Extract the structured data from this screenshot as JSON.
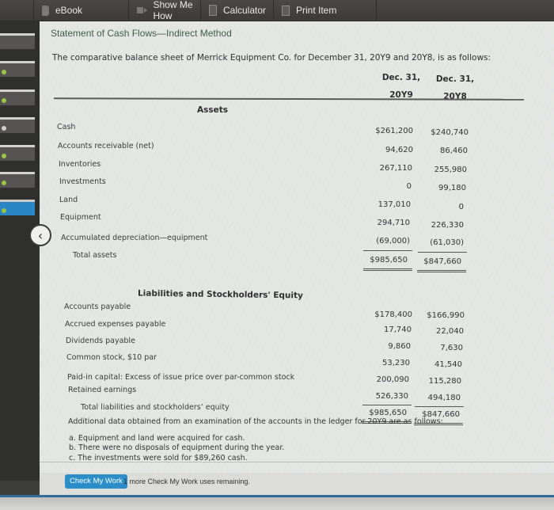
{
  "toolbar": {
    "items": [
      {
        "label": "eBook",
        "icon": "book-icon"
      },
      {
        "label": "Show Me How",
        "icon": "video-icon"
      },
      {
        "label": "Calculator",
        "icon": "calculator-icon"
      },
      {
        "label": "Print Item",
        "icon": "print-icon"
      }
    ]
  },
  "problem": {
    "title": "Statement of Cash Flows—Indirect Method",
    "intro": "The comparative balance sheet of Merrick Equipment Co. for December 31, 20Y9 and 20Y8, is as follows:",
    "columns": [
      {
        "line1": "Dec. 31,",
        "line2": "20Y9"
      },
      {
        "line1": "Dec. 31,",
        "line2": "20Y8"
      }
    ],
    "assets": {
      "heading": "Assets",
      "rows": [
        {
          "label": "Cash",
          "y9": "$261,200",
          "y8": "$240,740"
        },
        {
          "label": "Accounts receivable (net)",
          "y9": "94,620",
          "y8": "86,460"
        },
        {
          "label": "Inventories",
          "y9": "267,110",
          "y8": "255,980"
        },
        {
          "label": "Investments",
          "y9": "0",
          "y8": "99,180"
        },
        {
          "label": "Land",
          "y9": "137,010",
          "y8": "0"
        },
        {
          "label": "Equipment",
          "y9": "294,710",
          "y8": "226,330"
        },
        {
          "label": "Accumulated depreciation—equipment",
          "y9": "(69,000)",
          "y8": "(61,030)"
        }
      ],
      "total": {
        "label": "Total assets",
        "y9": "$985,650",
        "y8": "$847,660"
      }
    },
    "liabilities": {
      "heading": "Liabilities and Stockholders' Equity",
      "rows": [
        {
          "label": "Accounts payable",
          "y9": "$178,400",
          "y8": "$166,990"
        },
        {
          "label": "Accrued expenses payable",
          "y9": "17,740",
          "y8": "22,040"
        },
        {
          "label": "Dividends payable",
          "y9": "9,860",
          "y8": "7,630"
        },
        {
          "label": "Common stock, $10 par",
          "y9": "53,230",
          "y8": "41,540"
        },
        {
          "label": "Paid-in capital: Excess of issue price over par-common stock",
          "y9": "200,090",
          "y8": "115,280"
        },
        {
          "label": "Retained earnings",
          "y9": "526,330",
          "y8": "494,180"
        }
      ],
      "total": {
        "label": "Total liabilities and stockholders’ equity",
        "y9": "$985,650",
        "y8": "$847,660"
      }
    },
    "additional": {
      "intro": "Additional data obtained from an examination of the accounts in the ledger for 20Y9 are as follows:",
      "items": [
        "a.  Equipment and land were acquired for cash.",
        "b.  There were no disposals of equipment during the year.",
        "c.  The investments were sold for $89,260 cash."
      ]
    }
  },
  "footer": {
    "check_button": "Check My Work",
    "check_note": "1 more Check My Work uses remaining."
  }
}
